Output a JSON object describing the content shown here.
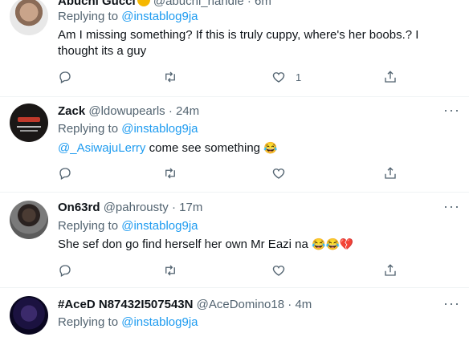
{
  "tweets": [
    {
      "name": "Abuchi Gucci",
      "handle": "@abuchi_handle",
      "time": "6m",
      "replying_prefix": "Replying to",
      "replying_to": "@instablog9ja",
      "text": "Am I missing something? If this is truly cuppy, where's her boobs.? I thought its a guy",
      "like_count": "1"
    },
    {
      "name": "Zack",
      "handle": "@ldowupearls",
      "time": "24m",
      "replying_prefix": "Replying to",
      "replying_to": "@instablog9ja",
      "text_mention": "@_AsiwajuLerry",
      "text": " come see something ",
      "emoji": "😂"
    },
    {
      "name": "On63rd",
      "handle": "@pahrousty",
      "time": "17m",
      "replying_prefix": "Replying to",
      "replying_to": "@instablog9ja",
      "text": "She sef don go find herself her own Mr Eazi na ",
      "emoji": "😂😂💔"
    },
    {
      "name": "#AceD N87432I507543N",
      "handle": "@AceDomino18",
      "time": "4m",
      "replying_prefix": "Replying to",
      "replying_to": "@instablog9ja"
    }
  ],
  "colors": {
    "accent": "#1d9bf0",
    "muted": "#536471",
    "text": "#0f1419",
    "divider": "#eff3f4"
  },
  "icons": [
    "reply-icon",
    "retweet-icon",
    "like-icon",
    "share-icon",
    "more-icon"
  ]
}
